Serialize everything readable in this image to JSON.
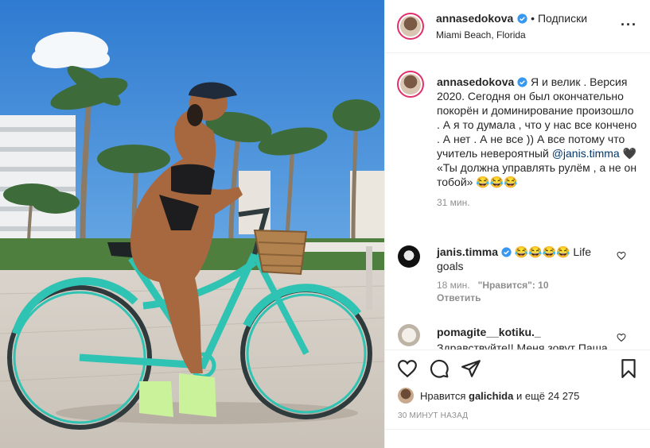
{
  "post": {
    "username": "annasedokova",
    "follow_label": "Подписки",
    "location": "Miami Beach, Florida"
  },
  "caption": {
    "username": "annasedokova",
    "text_part1": "Я и велик . Версия 2020. Сегодня он был окончательно покорён и доминирование произошло . А я то думала , что у нас все кончено . А нет . А не все )) А все потому что учитель невероятный",
    "mention": "@janis.timma",
    "text_part2": "🖤 «Ты должна управлять рулём , а не он тобой» 😂😂😂",
    "age": "31 мин."
  },
  "comments": [
    {
      "username": "janis.timma",
      "text": "😂😂😂😂 Life goals",
      "age": "18 мин.",
      "likes_label": "\"Нравится\": 10",
      "reply_label": "Ответить"
    },
    {
      "username": "pomagite__kotiku._",
      "text": "Здравствуйте!! Меня зовут Паша"
    }
  ],
  "likes": {
    "prefix": "Нравится",
    "user": "galichida",
    "suffix": "и ещё 24 275"
  },
  "timestamp": "30 МИНУТ НАЗАД",
  "icons": {
    "verified": "verified-badge-icon",
    "more": "more-options-icon",
    "like": "heart-icon",
    "comment": "comment-icon",
    "share": "share-icon",
    "save": "bookmark-icon"
  },
  "colors": {
    "verified": "#3897f0",
    "text": "#262626",
    "muted": "#8e8e8e",
    "mention": "#00376b",
    "bike": "#31c7b7"
  }
}
